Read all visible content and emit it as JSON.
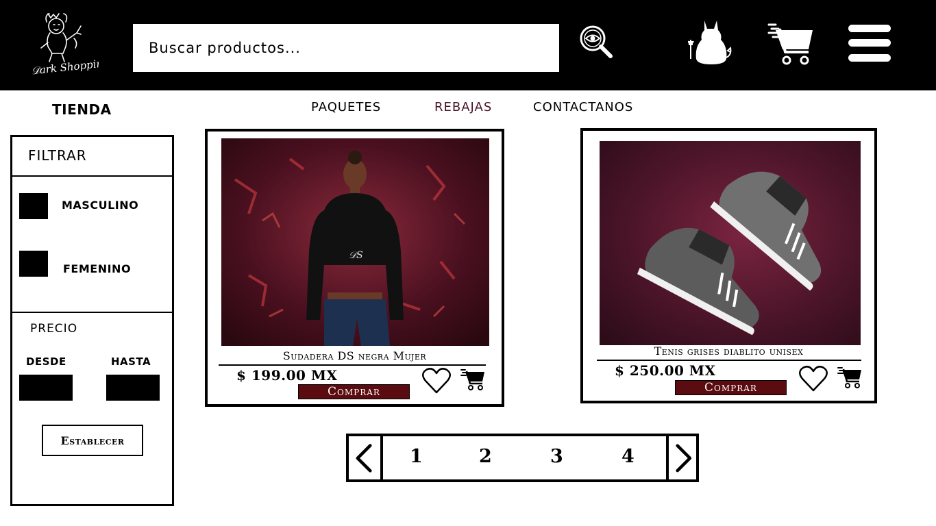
{
  "brand": {
    "logo_text": "Dark Shopping",
    "header_bg": "#000000"
  },
  "search": {
    "placeholder": "Buscar productos...",
    "icon": "eye-magnifier-icon"
  },
  "header_icons": {
    "account": "devil-cat-icon",
    "cart": "shopping-cart-icon",
    "menu": "hamburger-menu-icon"
  },
  "store_title": "TIENDA",
  "nav": {
    "packages": "PAQUETES",
    "sales": "REBAJAS",
    "contact": "CONTACTANOS",
    "active_color": "#4a1228"
  },
  "filter": {
    "title": "FILTRAR",
    "options": [
      {
        "label": "MASCULINO"
      },
      {
        "label": "FEMENINO"
      }
    ],
    "price_title": "PRECIO",
    "from_label": "DESDE",
    "to_label": "HASTA",
    "set_button": "Establecer"
  },
  "products": [
    {
      "name": "Sudadera DS negra Mujer",
      "price": "$ 199.00 MX",
      "buy_label": "Comprar",
      "image": "woman-black-hoodie-photo"
    },
    {
      "name": "Tenis grises diablito unisex",
      "price": "$ 250.00 MX",
      "buy_label": "Comprar",
      "image": "grey-sneakers-photo"
    }
  ],
  "pagination": {
    "pages": [
      "1",
      "2",
      "3",
      "4"
    ],
    "prev_icon": "chevron-left-icon",
    "next_icon": "chevron-right-icon"
  },
  "colors": {
    "buy_button": "#5a0c10",
    "image_bg": "#4a1020"
  }
}
